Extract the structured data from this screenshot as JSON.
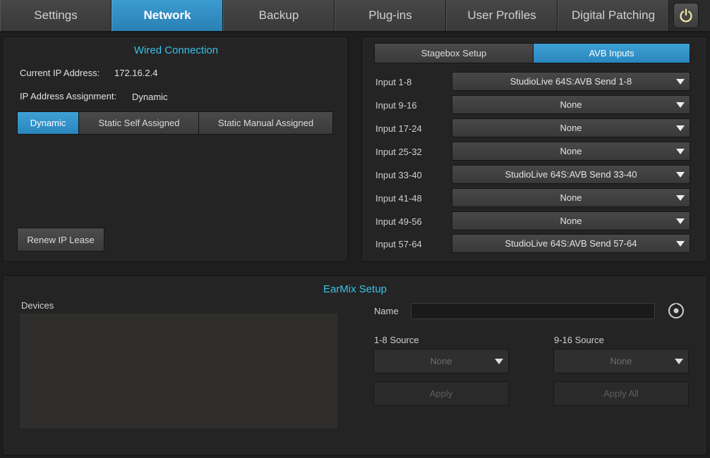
{
  "tabs": [
    {
      "label": "Settings"
    },
    {
      "label": "Network"
    },
    {
      "label": "Backup"
    },
    {
      "label": "Plug-ins"
    },
    {
      "label": "User Profiles"
    },
    {
      "label": "Digital Patching"
    }
  ],
  "active_tab": "Network",
  "accent_color": "#2b87bf",
  "title_color": "#38c2e8",
  "power_icon": "power-icon",
  "wired": {
    "title": "Wired Connection",
    "current_ip_label": "Current IP Address:",
    "current_ip_value": "172.16.2.4",
    "assignment_label": "IP Address Assignment:",
    "assignment_value": "Dynamic",
    "modes": [
      "Dynamic",
      "Static Self Assigned",
      "Static Manual Assigned"
    ],
    "active_mode": "Dynamic",
    "renew_label": "Renew IP Lease"
  },
  "avb": {
    "tabs": [
      "Stagebox Setup",
      "AVB Inputs"
    ],
    "active_tab": "AVB Inputs",
    "rows": [
      {
        "label": "Input 1-8",
        "value": "StudioLive 64S:AVB Send 1-8"
      },
      {
        "label": "Input 9-16",
        "value": "None"
      },
      {
        "label": "Input 17-24",
        "value": "None"
      },
      {
        "label": "Input 25-32",
        "value": "None"
      },
      {
        "label": "Input 33-40",
        "value": "StudioLive 64S:AVB Send 33-40"
      },
      {
        "label": "Input 41-48",
        "value": "None"
      },
      {
        "label": "Input 49-56",
        "value": "None"
      },
      {
        "label": "Input 57-64",
        "value": "StudioLive 64S:AVB Send 57-64"
      }
    ]
  },
  "earmix": {
    "title": "EarMix Setup",
    "devices_label": "Devices",
    "name_label": "Name",
    "name_value": "",
    "identify_icon": "identify-icon",
    "source_1_label": "1-8 Source",
    "source_1_value": "None",
    "source_2_label": "9-16 Source",
    "source_2_value": "None",
    "apply_label": "Apply",
    "apply_all_label": "Apply All"
  }
}
